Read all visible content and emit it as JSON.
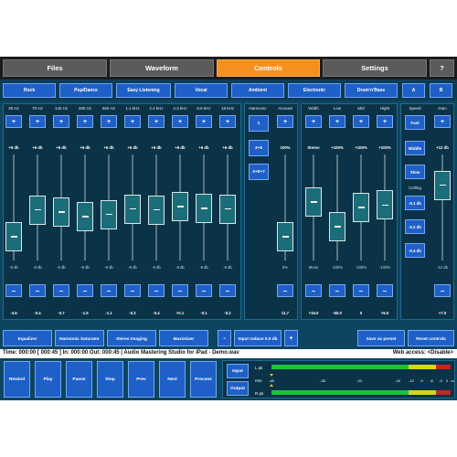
{
  "tabs": [
    {
      "label": "Files",
      "active": false
    },
    {
      "label": "Waveform",
      "active": false
    },
    {
      "label": "Controls",
      "active": true
    },
    {
      "label": "Settings",
      "active": false
    },
    {
      "label": "?",
      "active": false
    }
  ],
  "presets": [
    "Rock",
    "Pop/Dance",
    "Easy Listening",
    "Vocal",
    "Ambient",
    "Electronic",
    "Drum'n'Bass",
    "A",
    "B"
  ],
  "eq": {
    "bands": [
      {
        "freq": "35 Hz",
        "max": "+6 db",
        "min": "-6 db",
        "value": "-4.6",
        "level": 0.12
      },
      {
        "freq": "70 Hz",
        "max": "+6 db",
        "min": "-6 db",
        "value": "-0.4",
        "level": 0.47
      },
      {
        "freq": "140 Hz",
        "max": "+6 db",
        "min": "-6 db",
        "value": "-0.7",
        "level": 0.44
      },
      {
        "freq": "280 Hz",
        "max": "+6 db",
        "min": "-6 db",
        "value": "-1.5",
        "level": 0.38
      },
      {
        "freq": "560 Hz",
        "max": "+6 db",
        "min": "-6 db",
        "value": "-1.1",
        "level": 0.41
      },
      {
        "freq": "1.1 kHz",
        "max": "+6 db",
        "min": "-6 db",
        "value": "-0.2",
        "level": 0.48
      },
      {
        "freq": "2.2 kHz",
        "max": "+6 db",
        "min": "-6 db",
        "value": "-0.4",
        "level": 0.47
      },
      {
        "freq": "4.3 kHz",
        "max": "+6 db",
        "min": "-6 db",
        "value": "+0.1",
        "level": 0.51
      },
      {
        "freq": "8.6 kHz",
        "max": "+6 db",
        "min": "-6 db",
        "value": "-0.1",
        "level": 0.49
      },
      {
        "freq": "18 kHz",
        "max": "+6 db",
        "min": "-6 db",
        "value": "-0.2",
        "level": 0.48
      }
    ]
  },
  "harmonic": {
    "header": "Harmonic",
    "buttons": [
      "1",
      "3+5",
      "3+5+7"
    ],
    "amount_header": "Amount",
    "amount_max": "100%",
    "amount_min": "0%",
    "amount_value": "11.7",
    "amount_level": 0.12
  },
  "stereo": {
    "bands": [
      {
        "label": "Width",
        "max": "Stereo",
        "min": "Mono",
        "value": "+15.0",
        "level": 0.57
      },
      {
        "label": "Low",
        "max": "+100%",
        "min": "-100%",
        "value": "-50.0",
        "level": 0.25
      },
      {
        "label": "Mid",
        "max": "+100%",
        "min": "-100%",
        "value": "0",
        "level": 0.5
      },
      {
        "label": "Hight",
        "max": "+100%",
        "min": "-100%",
        "value": "+5.0",
        "level": 0.53
      }
    ]
  },
  "speed": {
    "header": "Speed",
    "buttons": [
      "Fast",
      "Middle",
      "Slow"
    ],
    "ceiling_label": "Ceiling",
    "ceiling_buttons": [
      "-0.1 db",
      "-0.2 db",
      "-0.4 db"
    ]
  },
  "gain": {
    "header": "Gain",
    "max": "+12 db",
    "min": "-12 db",
    "value": "+7.0",
    "level": 0.79
  },
  "bottom_buttons": {
    "equalizer": "Equalizer",
    "harmonic_saturator": "Harmonic Saturator",
    "stereo_imaging": "Stereo Imaging",
    "maximizer": "Maximizer",
    "minus": "-",
    "input_reduce": "Input reduce 0.0 db",
    "plus": "+",
    "save_preset": "Save as preset",
    "reset_controls": "Reset controls"
  },
  "status": {
    "left": "Time: 000:00  [ 000:45 ]  In: 000:00  Out: 000:45  |  Audio Mastering Studio for iPad - Demo.wav",
    "right": "Web access: <Disable>"
  },
  "transport": [
    "Rewind",
    "Play",
    "Pause",
    "Stop",
    "Prev",
    "Next",
    "Process"
  ],
  "io": {
    "input": "Input",
    "output": "Output"
  },
  "meter": {
    "l_label": "L pk",
    "r_label": "R pk",
    "rms_label": "rms",
    "scale": [
      "-45",
      "-35",
      "-20",
      "-15",
      "-12",
      "-9",
      "-6",
      "-3",
      "0",
      "ovr"
    ],
    "green": "#19c43a",
    "yellow": "#d6d619",
    "red": "#c82424"
  },
  "colors": {
    "accent": "#f5901e",
    "button": "#1f60c8",
    "panel": "#0b3347"
  }
}
